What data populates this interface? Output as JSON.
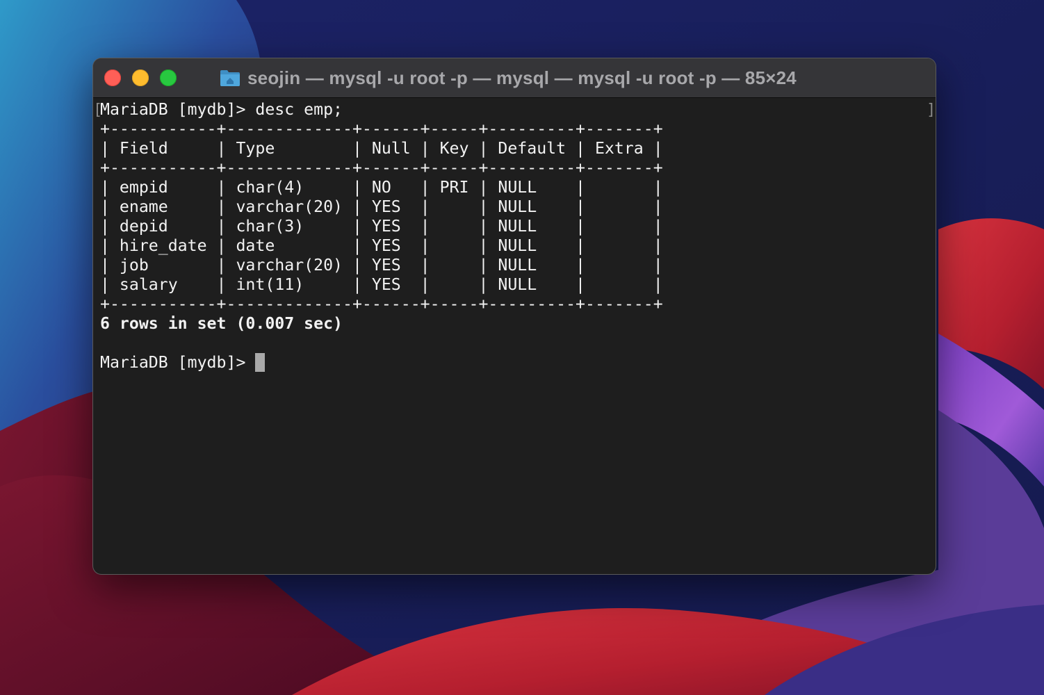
{
  "window": {
    "title": "seojin — mysql -u root -p — mysql — mysql -u root -p — 85×24",
    "title_icon": "folder-icon",
    "buttons": {
      "close": "close-icon",
      "minimize": "minimize-icon",
      "maximize": "maximize-icon"
    }
  },
  "terminal": {
    "command_line": "MariaDB [mydb]> desc emp;",
    "separator": "+-----------+-------------+------+-----+---------+-------+",
    "header_row": "| Field     | Type        | Null | Key | Default | Extra |",
    "rows": [
      "| empid     | char(4)     | NO   | PRI | NULL    |       |",
      "| ename     | varchar(20) | YES  |     | NULL    |       |",
      "| depid     | char(3)     | YES  |     | NULL    |       |",
      "| hire_date | date        | YES  |     | NULL    |       |",
      "| job       | varchar(20) | YES  |     | NULL    |       |",
      "| salary    | int(11)     | YES  |     | NULL    |       |"
    ],
    "summary": "6 rows in set (0.007 sec)",
    "prompt": "MariaDB [mydb]> ",
    "mark_open": "[",
    "mark_close": "]"
  },
  "colors": {
    "window_bg": "#1e1e1e",
    "titlebar_bg": "#353538",
    "text": "#f2f2f2",
    "close": "#ff5f57",
    "minimize": "#febc2e",
    "maximize": "#28c840"
  }
}
